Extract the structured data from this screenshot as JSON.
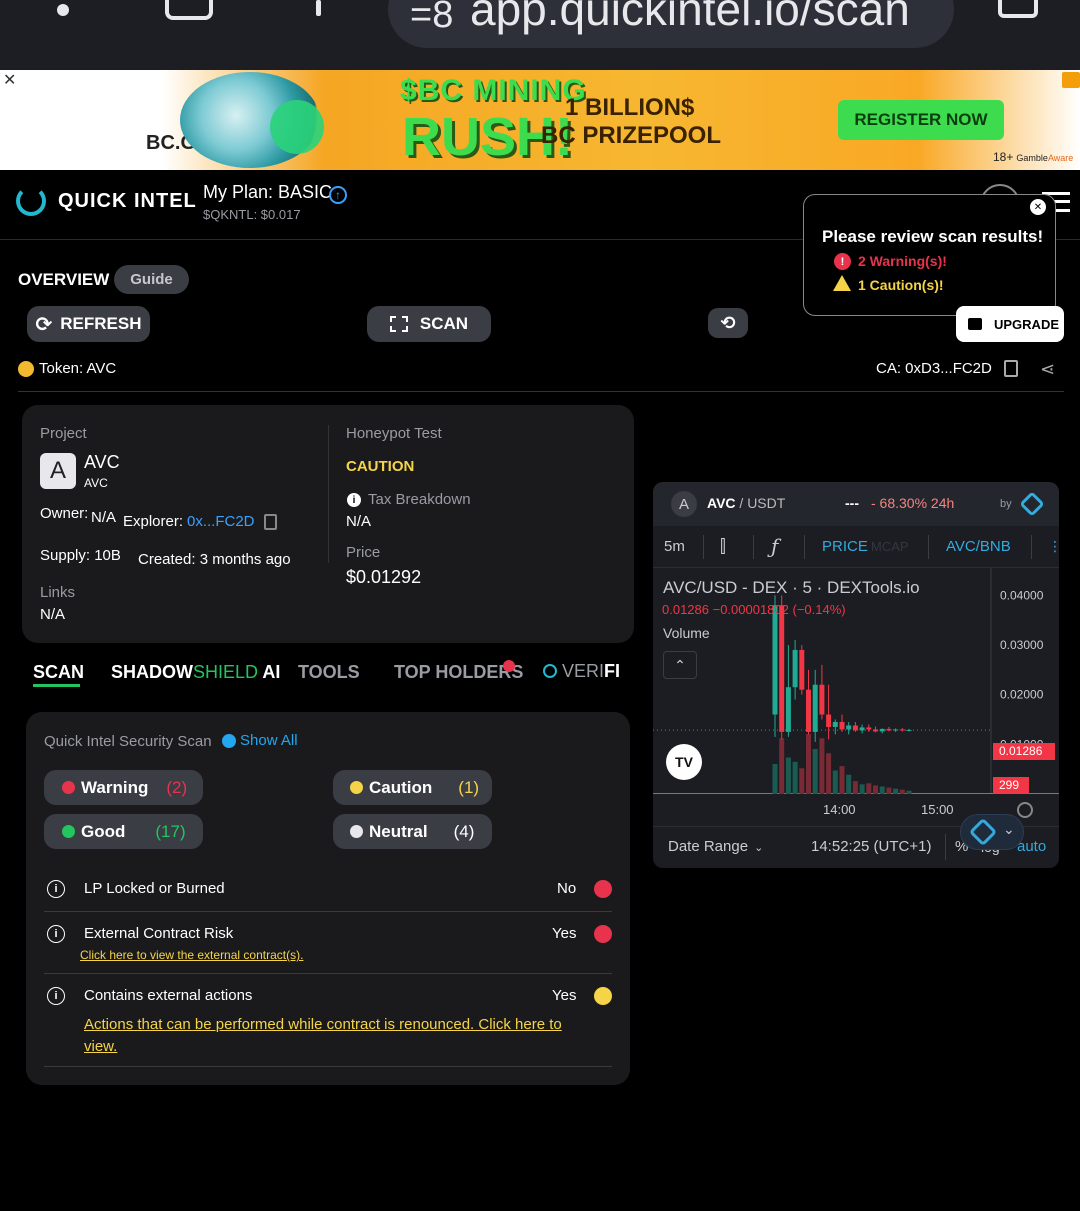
{
  "browser": {
    "url": "app.quickintel.io/scan"
  },
  "ad": {
    "brand": "BC.GA",
    "headline_top": "$BC MINING",
    "headline_bottom": "RUSH!",
    "prize_line1": "1 BILLION$",
    "prize_line2": "BC PRIZEPOOL",
    "cta": "REGISTER NOW",
    "age": "18+",
    "gamble": "Gamble",
    "aware": "Aware"
  },
  "header": {
    "logo": "QUICK INTEL",
    "plan": "My Plan: BASIC",
    "token_price": "$QKNTL: $0.017"
  },
  "toast": {
    "title": "Please review scan results!",
    "warning": "2 Warning(s)!",
    "caution": "1 Caution(s)!"
  },
  "overview": {
    "title": "OVERVIEW",
    "guide": "Guide",
    "refresh": "REFRESH",
    "scan": "SCAN",
    "upgrade": "UPGRADE",
    "token": "Token: AVC",
    "ca": "CA: 0xD3...FC2D"
  },
  "project": {
    "label": "Project",
    "avatar_letter": "A",
    "name": "AVC",
    "symbol": "AVC",
    "owner_label": "Owner:",
    "owner_value": "N/A",
    "explorer_label": "Explorer:",
    "explorer_value": "0x...FC2D",
    "supply": "Supply: 10B",
    "created": "Created: 3 months ago",
    "links_label": "Links",
    "links_value": "N/A",
    "honeypot_label": "Honeypot Test",
    "honeypot_value": "CAUTION",
    "tax_label": "Tax Breakdown",
    "tax_value": "N/A",
    "price_label": "Price",
    "price_value": "$0.01292"
  },
  "tabs": {
    "scan": "SCAN",
    "shadow": "SHADOW",
    "shield": "SHIELD",
    "ai": "AI",
    "tools": "TOOLS",
    "holders": "TOP HOLDERS",
    "veri": "VERI",
    "fi": "FI"
  },
  "security": {
    "title": "Quick Intel Security Scan",
    "show_all": "Show All",
    "warning_label": "Warning",
    "warning_count": "(2)",
    "caution_label": "Caution",
    "caution_count": "(1)",
    "good_label": "Good",
    "good_count": "(17)",
    "neutral_label": "Neutral",
    "neutral_count": "(4)",
    "rows": [
      {
        "label": "LP Locked or Burned",
        "value": "No",
        "status": "#e8334d",
        "link": ""
      },
      {
        "label": "External Contract Risk",
        "value": "Yes",
        "status": "#e8334d",
        "link": "Click here to view the external contract(s)."
      },
      {
        "label": "Contains external actions",
        "value": "Yes",
        "status": "#f5d547",
        "link": "Actions that can be performed while contract is renounced. Click here to view."
      }
    ]
  },
  "chart_widget": {
    "avatar": "A",
    "pair_base": "AVC",
    "pair_quote": " / USDT",
    "dashes": "---",
    "change": "- 68.30% 24h",
    "by": "by",
    "interval": "5m",
    "price_tab": "PRICE",
    "price_tab_hidden": "MCAP",
    "pair_tab": "AVC/BNB",
    "legend_title": "AVC/USD - DEX · 5 · DEXTools.io",
    "legend_ohlc": "0.01286  −0.00001802 (−0.14%)",
    "volume": "Volume",
    "current_price_tag": "0.01286",
    "volume_tag": "299",
    "date_range": "Date Range",
    "time": "14:52:25 (UTC+1)",
    "pct": "%",
    "log": "log",
    "auto": "auto"
  },
  "chart_data": {
    "type": "candlestick",
    "title": "AVC/USD - DEX · 5 · DEXTools.io",
    "y_ticks": [
      "0.04000",
      "0.03000",
      "0.02000",
      "0.01000"
    ],
    "x_ticks": [
      "14:00",
      "15:00"
    ],
    "ylim": [
      0.0,
      0.0455
    ],
    "current": 0.01286,
    "candles": [
      {
        "o": 0.016,
        "h": 0.04,
        "l": 0.0115,
        "c": 0.038,
        "v": 140
      },
      {
        "o": 0.038,
        "h": 0.04,
        "l": 0.011,
        "c": 0.0125,
        "v": 260
      },
      {
        "o": 0.0125,
        "h": 0.03,
        "l": 0.0115,
        "c": 0.0215,
        "v": 170
      },
      {
        "o": 0.0215,
        "h": 0.031,
        "l": 0.019,
        "c": 0.029,
        "v": 150
      },
      {
        "o": 0.029,
        "h": 0.03,
        "l": 0.02,
        "c": 0.021,
        "v": 120
      },
      {
        "o": 0.021,
        "h": 0.025,
        "l": 0.012,
        "c": 0.0125,
        "v": 280
      },
      {
        "o": 0.0125,
        "h": 0.025,
        "l": 0.0105,
        "c": 0.022,
        "v": 210
      },
      {
        "o": 0.022,
        "h": 0.026,
        "l": 0.015,
        "c": 0.016,
        "v": 260
      },
      {
        "o": 0.016,
        "h": 0.022,
        "l": 0.011,
        "c": 0.0135,
        "v": 190
      },
      {
        "o": 0.0135,
        "h": 0.015,
        "l": 0.012,
        "c": 0.0145,
        "v": 110
      },
      {
        "o": 0.0145,
        "h": 0.016,
        "l": 0.0125,
        "c": 0.013,
        "v": 130
      },
      {
        "o": 0.013,
        "h": 0.0145,
        "l": 0.012,
        "c": 0.0138,
        "v": 90
      },
      {
        "o": 0.0138,
        "h": 0.0145,
        "l": 0.0125,
        "c": 0.0128,
        "v": 60
      },
      {
        "o": 0.0128,
        "h": 0.014,
        "l": 0.0122,
        "c": 0.0134,
        "v": 45
      },
      {
        "o": 0.0134,
        "h": 0.014,
        "l": 0.0125,
        "c": 0.013,
        "v": 50
      },
      {
        "o": 0.013,
        "h": 0.0136,
        "l": 0.0124,
        "c": 0.0126,
        "v": 40
      },
      {
        "o": 0.0126,
        "h": 0.0132,
        "l": 0.0122,
        "c": 0.0131,
        "v": 35
      },
      {
        "o": 0.0131,
        "h": 0.0135,
        "l": 0.0126,
        "c": 0.0128,
        "v": 30
      },
      {
        "o": 0.0128,
        "h": 0.0132,
        "l": 0.0125,
        "c": 0.013,
        "v": 25
      },
      {
        "o": 0.013,
        "h": 0.0133,
        "l": 0.0126,
        "c": 0.0128,
        "v": 20
      },
      {
        "o": 0.0128,
        "h": 0.0131,
        "l": 0.0126,
        "c": 0.0129,
        "v": 15
      }
    ],
    "colors": {
      "up": "#22ab94",
      "down": "#f23645",
      "up_vol": "#1a5c51",
      "down_vol": "#7a2a34"
    }
  }
}
